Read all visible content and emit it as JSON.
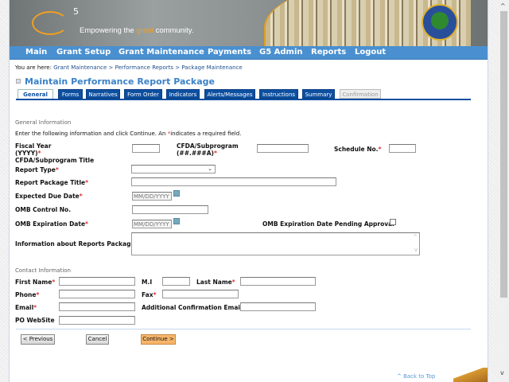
{
  "header": {
    "logo": "G5",
    "tagline_pre": "Empowering the ",
    "tagline_hl": "grant",
    "tagline_post": " community.",
    "seal": "Department of Education seal"
  },
  "nav": [
    "Main",
    "Grant Setup",
    "Grant Maintenance",
    "Payments",
    "G5 Admin",
    "Reports",
    "Logout"
  ],
  "breadcrumb": {
    "prefix": "You are here: ",
    "items": [
      "Grant Maintenance",
      "Performance Reports",
      "Package Maintenance"
    ],
    "sep": " > "
  },
  "page_title": "Maintain Performance Report Package",
  "tabs": [
    {
      "label": "General",
      "state": "active"
    },
    {
      "label": "Forms"
    },
    {
      "label": "Narratives"
    },
    {
      "label": "Form Order"
    },
    {
      "label": "Indicators"
    },
    {
      "label": "Alerts/Messages"
    },
    {
      "label": "Instructions"
    },
    {
      "label": "Summary"
    },
    {
      "label": "Confirmation",
      "state": "disabled"
    }
  ],
  "general": {
    "heading": "General Information",
    "intro_pre": "Enter the following information and click Continue.  An ",
    "intro_star": "*",
    "intro_post": "indicates a required field.",
    "fiscal_year": "Fiscal Year",
    "fiscal_year2": "(YYYY)",
    "cfda": "CFDA/Subprogram",
    "cfda2": "(##.###A)",
    "schedule": "Schedule No.",
    "cfda_title": "CFDA/Subprogram Title",
    "report_type": "Report Type",
    "package_title": "Report Package Title",
    "due_date": "Expected Due Date",
    "date_placeholder": "MM/DD/YYYY",
    "omb_control": "OMB Control No.",
    "omb_exp": "OMB Expiration Date",
    "omb_pending": "OMB Expiration Date Pending Approval",
    "info": "Information about Reports Package",
    "star": "*"
  },
  "contact": {
    "heading": "Contact Information",
    "first": "First Name",
    "mi": "M.I",
    "last": "Last Name",
    "phone": "Phone",
    "fax": "Fax",
    "email": "Email",
    "add_email": "Additional Confirmation Email",
    "website": "PO WebSite"
  },
  "buttons": {
    "previous": "< Previous",
    "cancel": "Cancel",
    "continue": "Continue >"
  },
  "back_to_top": "^ Back to Top"
}
